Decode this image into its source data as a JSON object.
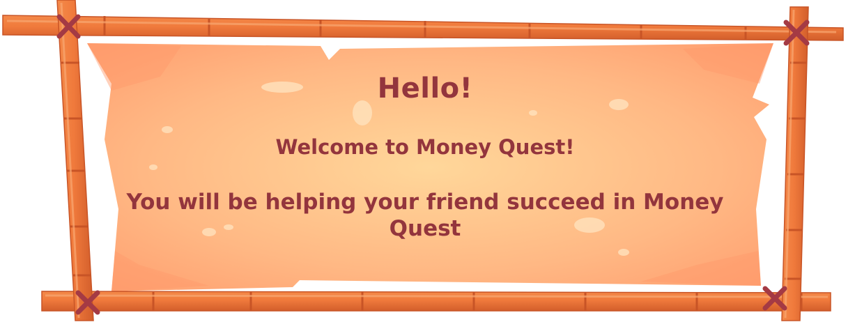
{
  "sign": {
    "greeting": "Hello!",
    "welcome": "Welcome to Money Quest!",
    "message": "You will be helping your friend succeed in Money Quest"
  },
  "colors": {
    "text": "#93353d",
    "parchment_center": "#ffd79a",
    "parchment_edge": "#ff9d6e",
    "bamboo": "#f07a3c",
    "bamboo_dark": "#c85426",
    "tie": "#a43a44"
  },
  "icons": {
    "ties": "x-lashing-icon"
  }
}
